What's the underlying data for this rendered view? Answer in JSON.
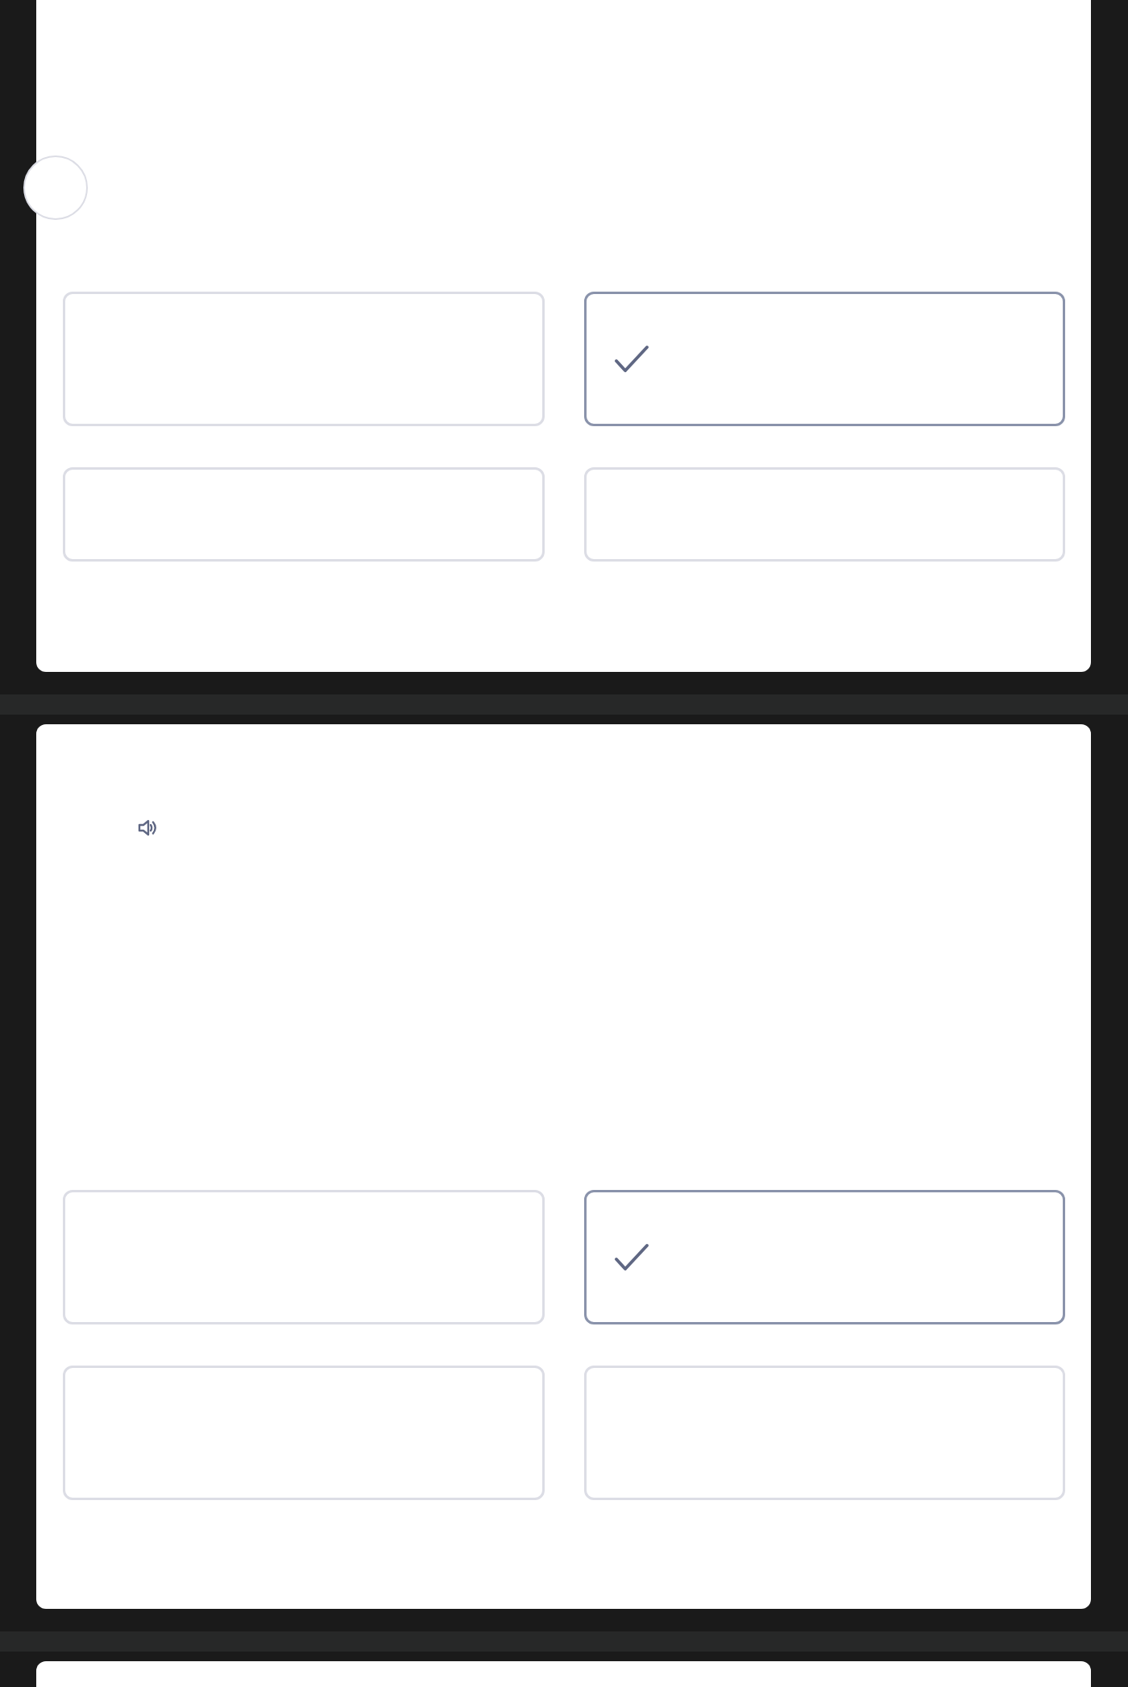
{
  "cards": [
    {
      "kind": "avatar-question",
      "options": [
        {
          "selected": false
        },
        {
          "selected": true
        },
        {
          "selected": false
        },
        {
          "selected": false
        }
      ]
    },
    {
      "kind": "audio-question",
      "options": [
        {
          "selected": false
        },
        {
          "selected": true
        },
        {
          "selected": false
        },
        {
          "selected": false
        }
      ]
    },
    {
      "kind": "partial"
    }
  ]
}
